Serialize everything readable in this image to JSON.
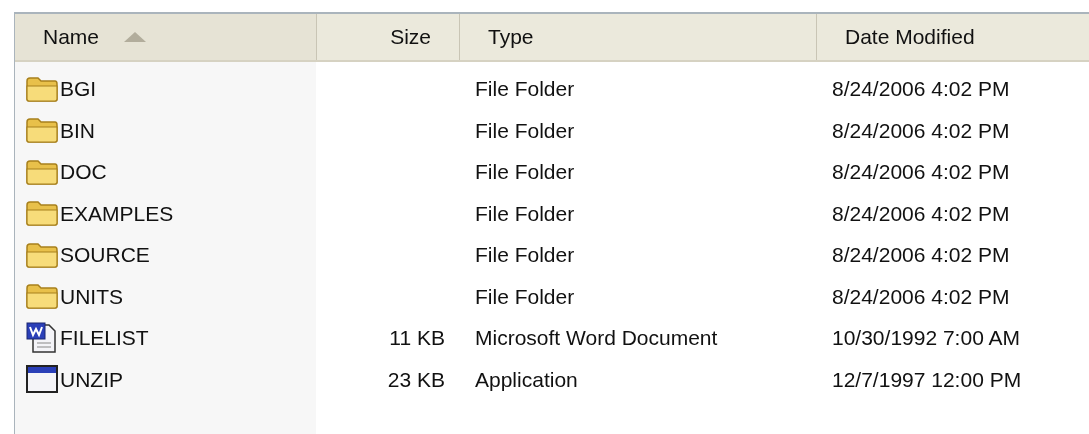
{
  "table": {
    "columns": [
      {
        "label": "Name",
        "sorted": true
      },
      {
        "label": "Size",
        "sorted": false
      },
      {
        "label": "Type",
        "sorted": false
      },
      {
        "label": "Date Modified",
        "sorted": false
      }
    ],
    "rows": [
      {
        "kind": "folder",
        "name": "BGI",
        "type": "File Folder",
        "date": "8/24/2006 4:02 PM"
      },
      {
        "kind": "folder",
        "name": "BIN",
        "type": "File Folder",
        "date": "8/24/2006 4:02 PM"
      },
      {
        "kind": "folder",
        "name": "DOC",
        "type": "File Folder",
        "date": "8/24/2006 4:02 PM"
      },
      {
        "kind": "folder",
        "name": "EXAMPLES",
        "type": "File Folder",
        "date": "8/24/2006 4:02 PM"
      },
      {
        "kind": "folder",
        "name": "SOURCE",
        "type": "File Folder",
        "date": "8/24/2006 4:02 PM"
      },
      {
        "kind": "folder",
        "name": "UNITS",
        "type": "File Folder",
        "date": "8/24/2006 4:02 PM"
      },
      {
        "kind": "document",
        "name": "FILELIST",
        "size": "11 KB",
        "type": "Microsoft Word Document",
        "date": "10/30/1992 7:00 AM"
      },
      {
        "kind": "application",
        "name": "UNZIP",
        "size": "23 KB",
        "type": "Application",
        "date": "12/7/1997 12:00 PM"
      }
    ]
  }
}
